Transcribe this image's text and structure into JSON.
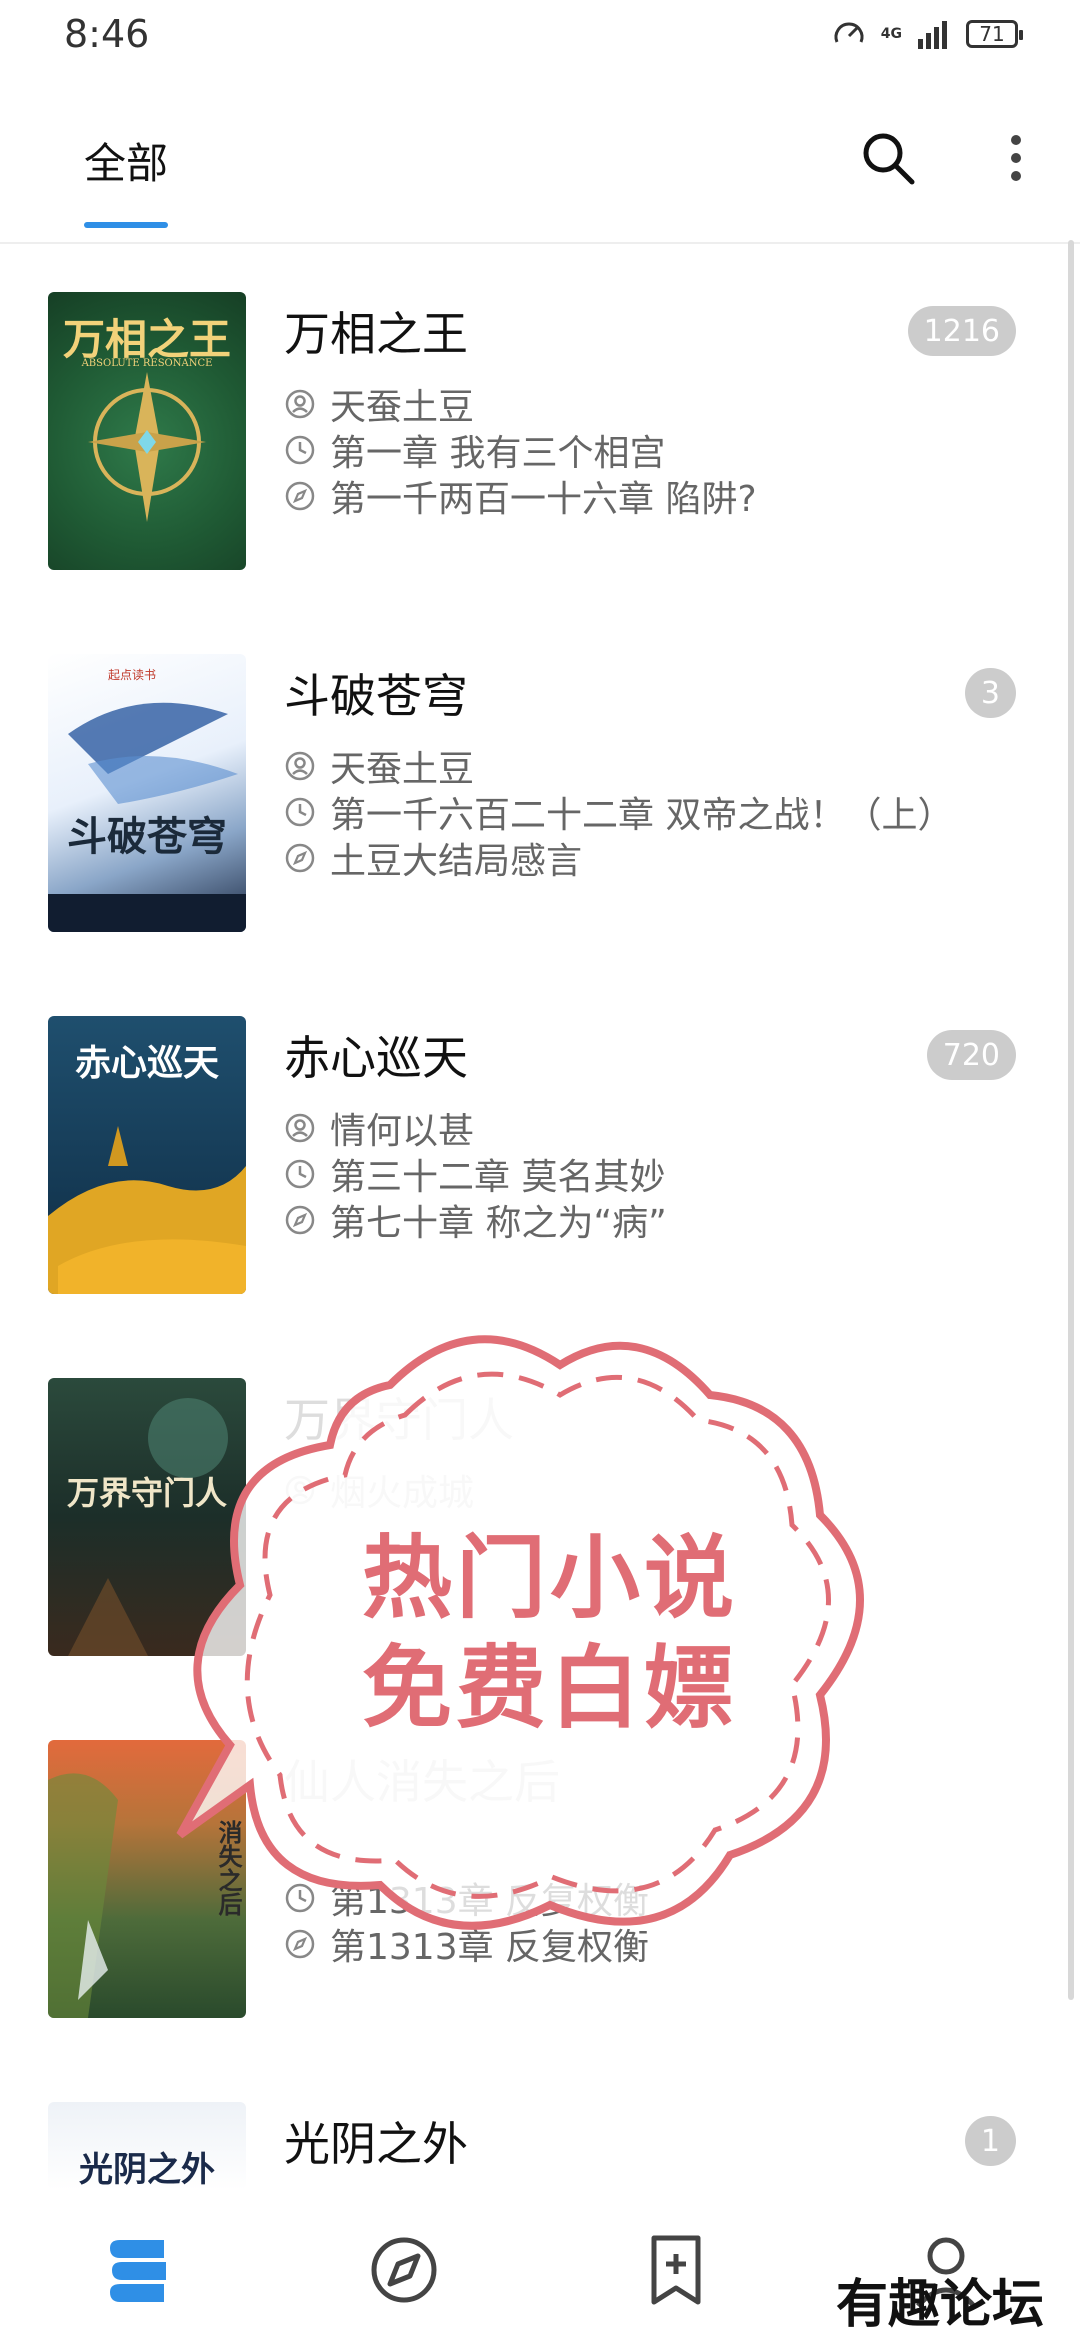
{
  "status_bar": {
    "time": "8:46",
    "network": "4G",
    "battery": "71"
  },
  "header": {
    "tab_label": "全部",
    "accent_color": "#2f8fe6"
  },
  "books": [
    {
      "title": "万相之王",
      "author": "天蚕土豆",
      "last_read": "第一章 我有三个相宫",
      "latest": "第一千两百一十六章 陷阱?",
      "badge": "1216",
      "cover_text": "万相之王",
      "cover_subtext": "ABSOLUTE RESONANCE"
    },
    {
      "title": "斗破苍穹",
      "author": "天蚕土豆",
      "last_read": "第一千六百二十二章 双帝之战！（上）",
      "latest": "土豆大结局感言",
      "badge": "3",
      "cover_text": "斗破苍穹",
      "cover_subtext": "起点读书"
    },
    {
      "title": "赤心巡天",
      "author": "情何以甚",
      "last_read": "第三十二章 莫名其妙",
      "latest": "第七十章 称之为“病”",
      "badge": "720",
      "cover_text": "赤心巡天"
    },
    {
      "title": "万界守门人",
      "author": "烟火成城",
      "last_read": "",
      "latest": "",
      "badge": "",
      "cover_text": "万界守门人"
    },
    {
      "title": "仙人消失之后",
      "author": "",
      "last_read": "第1313章 反复权衡",
      "latest": "第1313章 反复权衡",
      "badge": "",
      "cover_text": "消失之后"
    },
    {
      "title": "光阴之外",
      "author": "",
      "last_read": "",
      "latest": "",
      "badge": "1",
      "cover_text": "光阴之外"
    }
  ],
  "watermark": {
    "line1": "热门小说",
    "line2": "免费白嫖",
    "color": "#e06d75"
  },
  "forum_logo": "有趣论坛"
}
